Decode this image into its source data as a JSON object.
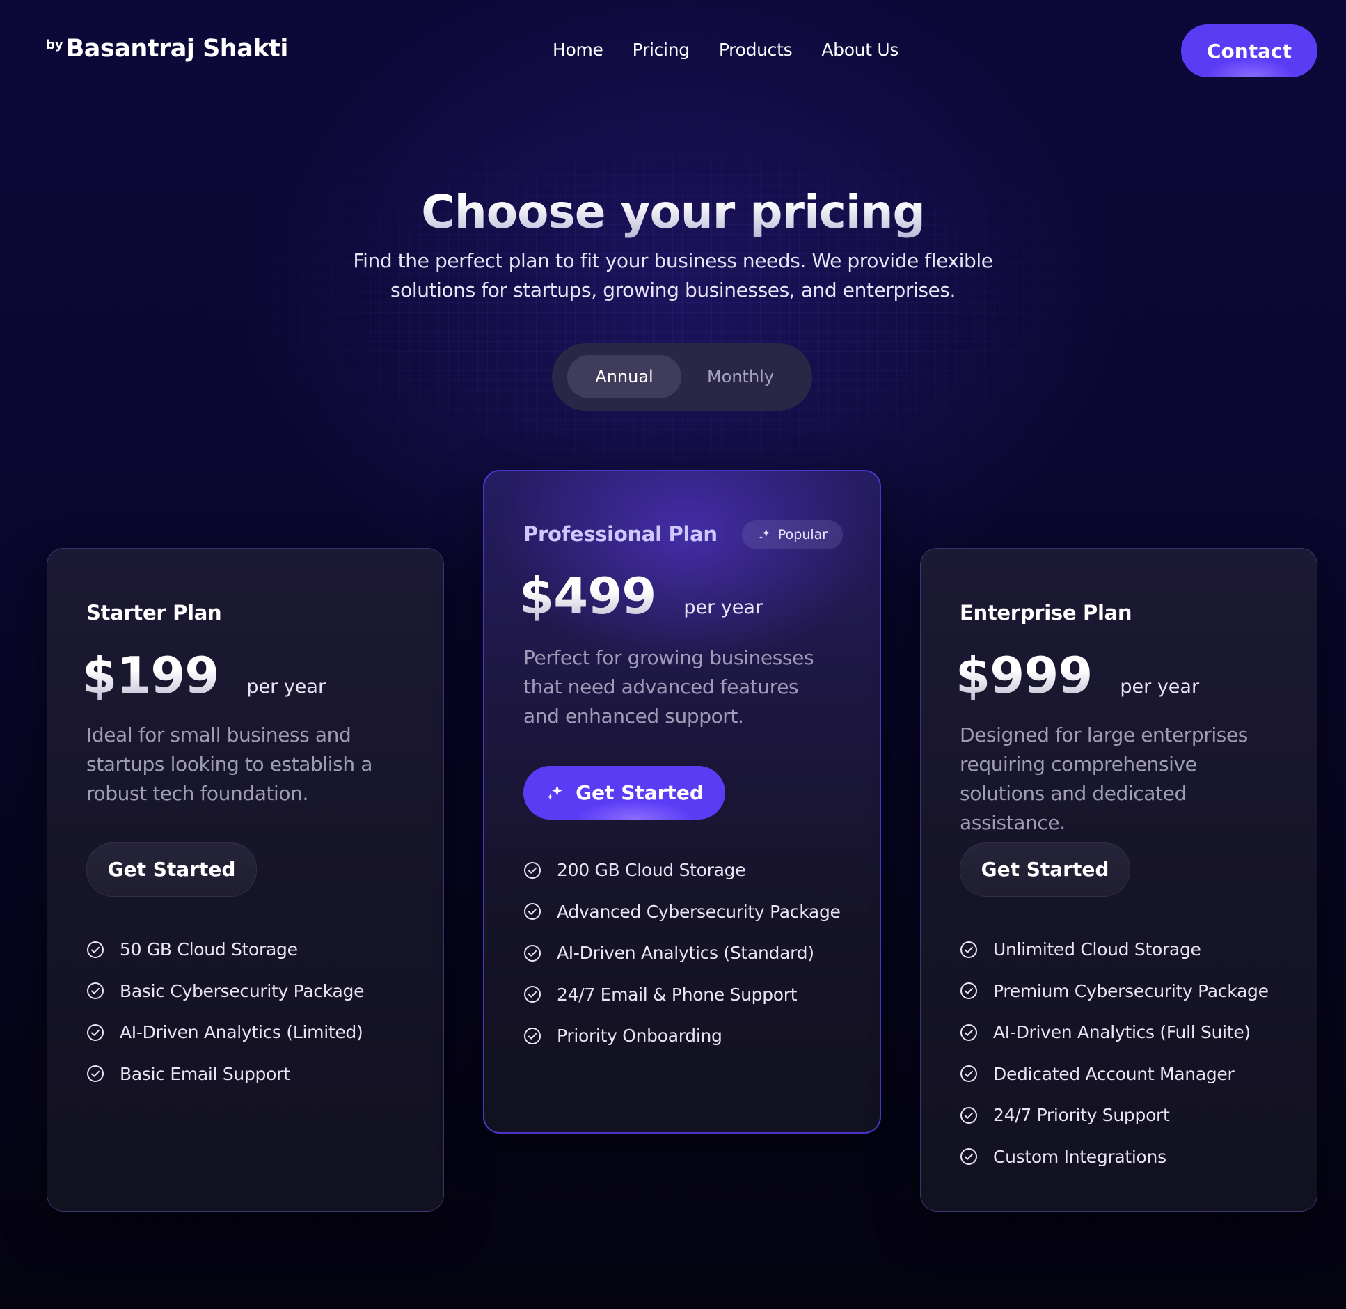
{
  "header": {
    "logo_by": "by",
    "logo_name": "Basantraj Shakti",
    "nav": [
      "Home",
      "Pricing",
      "Products",
      "About Us"
    ],
    "contact_label": "Contact"
  },
  "hero": {
    "title": "Choose your pricing",
    "subtitle": "Find the perfect plan to fit your business needs. We provide flexible solutions for startups, growing businesses, and enterprises."
  },
  "billing_toggle": {
    "selected": "Annual",
    "options": [
      "Annual",
      "Monthly"
    ]
  },
  "plans": [
    {
      "name": "Starter Plan",
      "price": "$199",
      "period": "per year",
      "description": "Ideal for small business and startups looking to establish a robust tech foundation.",
      "cta": "Get Started",
      "features": [
        "50 GB Cloud Storage",
        "Basic Cybersecurity Package",
        "AI-Driven Analytics (Limited)",
        "Basic Email Support"
      ]
    },
    {
      "name": "Professional Plan",
      "badge": "Popular",
      "price": "$499",
      "period": "per year",
      "description": "Perfect for growing businesses that need advanced features and enhanced support.",
      "cta": "Get Started",
      "features": [
        "200 GB Cloud Storage",
        "Advanced Cybersecurity Package",
        "AI-Driven Analytics (Standard)",
        "24/7 Email & Phone Support",
        "Priority Onboarding"
      ]
    },
    {
      "name": "Enterprise Plan",
      "price": "$999",
      "period": "per year",
      "description": "Designed for large enterprises requiring comprehensive solutions and dedicated assistance.",
      "cta": "Get Started",
      "features": [
        "Unlimited Cloud Storage",
        "Premium Cybersecurity Package",
        "AI-Driven Analytics (Full Suite)",
        "Dedicated Account Manager",
        "24/7 Priority Support",
        "Custom Integrations"
      ]
    }
  ],
  "icons": {
    "feature": "check-circle-icon",
    "sparkle": "sparkle-icon"
  },
  "colors": {
    "accent": "#5b3cf5",
    "background": "#0a0830",
    "card": "#1a1830"
  }
}
